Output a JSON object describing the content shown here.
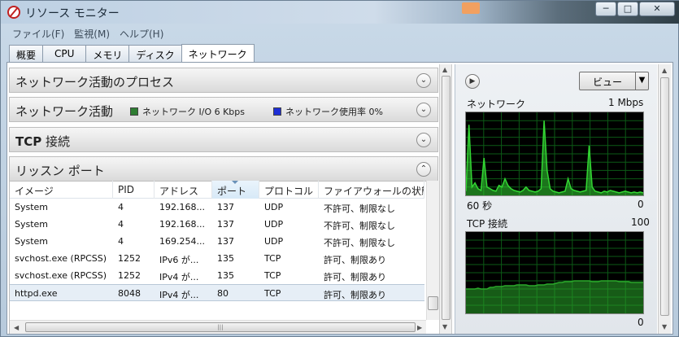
{
  "window": {
    "title": "リソース モニター",
    "minimize": "─",
    "maximize": "□",
    "close": "✕"
  },
  "menu": [
    "ファイル(F)",
    "監視(M)",
    "ヘルプ(H)"
  ],
  "tabs": [
    "概要",
    "CPU",
    "メモリ",
    "ディスク",
    "ネットワーク"
  ],
  "active_tab": "ネットワーク",
  "sections": {
    "processes": {
      "title": "ネットワーク活動のプロセス"
    },
    "activity": {
      "title": "ネットワーク活動",
      "legend_io": "ネットワーク I/O 6 Kbps",
      "legend_io_color": "#2e7d32",
      "legend_util": "ネットワーク使用率 0%",
      "legend_util_color": "#1e2fd6"
    },
    "tcp": {
      "title_bold": "TCP",
      "title_rest": " 接続"
    },
    "listening": {
      "title": "リッスン ポート"
    }
  },
  "ports_table": {
    "columns": [
      "イメージ",
      "PID",
      "アドレス",
      "ポート",
      "プロトコル",
      "ファイアウォールの状態"
    ],
    "sorted_column": "ポート",
    "rows": [
      {
        "image": "System",
        "pid": "4",
        "address": "192.168...",
        "port": "137",
        "protocol": "UDP",
        "firewall": "不許可、制限なし"
      },
      {
        "image": "System",
        "pid": "4",
        "address": "192.168...",
        "port": "137",
        "protocol": "UDP",
        "firewall": "不許可、制限なし"
      },
      {
        "image": "System",
        "pid": "4",
        "address": "169.254...",
        "port": "137",
        "protocol": "UDP",
        "firewall": "不許可、制限なし"
      },
      {
        "image": "svchost.exe (RPCSS)",
        "pid": "1252",
        "address": "IPv6 が...",
        "port": "135",
        "protocol": "TCP",
        "firewall": "許可、制限あり"
      },
      {
        "image": "svchost.exe (RPCSS)",
        "pid": "1252",
        "address": "IPv4 が...",
        "port": "135",
        "protocol": "TCP",
        "firewall": "許可、制限あり"
      },
      {
        "image": "httpd.exe",
        "pid": "8048",
        "address": "IPv4 が...",
        "port": "80",
        "protocol": "TCP",
        "firewall": "許可、制限あり"
      }
    ],
    "selected_row": 5
  },
  "right_panel": {
    "view_button": "ビュー",
    "network_graph": {
      "label": "ネットワーク",
      "max_label": "1 Mbps",
      "time_label": "60 秒",
      "min_label": "0",
      "values": [
        0.05,
        0.85,
        0.1,
        0.15,
        0.08,
        0.06,
        0.45,
        0.1,
        0.08,
        0.06,
        0.05,
        0.12,
        0.1,
        0.2,
        0.12,
        0.08,
        0.06,
        0.05,
        0.04,
        0.06,
        0.1,
        0.06,
        0.05,
        0.04,
        0.05,
        0.08,
        0.9,
        0.3,
        0.08,
        0.05,
        0.04,
        0.03,
        0.04,
        0.05,
        0.2,
        0.08,
        0.06,
        0.05,
        0.04,
        0.05,
        0.06,
        0.6,
        0.1,
        0.05,
        0.04,
        0.03,
        0.05,
        0.04,
        0.06,
        0.05,
        0.04,
        0.03,
        0.04,
        0.05,
        0.04,
        0.03,
        0.04,
        0.03,
        0.04,
        0.03
      ],
      "color": "#33d633"
    },
    "tcp_graph": {
      "label": "TCP 接続",
      "max_label": "100",
      "min_label": "0",
      "values": [
        0.3,
        0.3,
        0.3,
        0.3,
        0.31,
        0.3,
        0.3,
        0.3,
        0.32,
        0.32,
        0.33,
        0.33,
        0.33,
        0.34,
        0.34,
        0.34,
        0.34,
        0.35,
        0.35,
        0.35,
        0.35,
        0.34,
        0.34,
        0.34,
        0.35,
        0.35,
        0.35,
        0.36,
        0.36,
        0.36,
        0.37,
        0.38,
        0.38,
        0.39,
        0.39,
        0.39,
        0.4,
        0.4,
        0.4,
        0.4,
        0.4,
        0.4,
        0.39,
        0.39,
        0.39,
        0.4,
        0.4,
        0.4,
        0.4,
        0.4,
        0.4,
        0.39,
        0.39,
        0.39,
        0.39,
        0.38,
        0.38,
        0.38,
        0.38,
        0.38
      ],
      "color": "#2aa82a"
    }
  }
}
